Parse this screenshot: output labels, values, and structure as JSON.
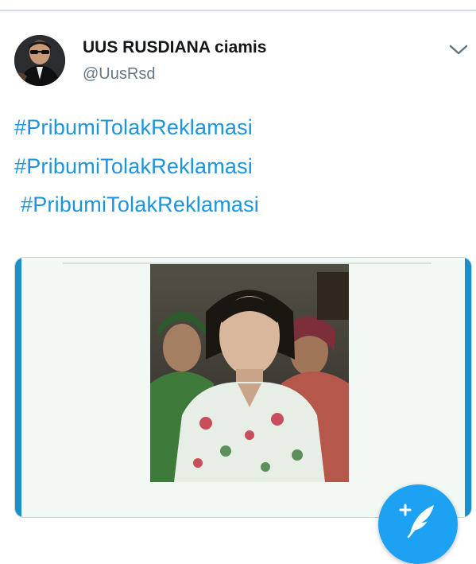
{
  "tweet": {
    "display_name": "UUS RUSDIANA ciamis",
    "handle": "@UusRsd",
    "hashtags": [
      "#PribumiTolakReklamasi",
      "#PribumiTolakReklamasi",
      "#PribumiTolakReklamasi"
    ]
  },
  "icons": {
    "menu": "chevron-down-icon",
    "compose": "compose-tweet-icon"
  },
  "colors": {
    "link": "#1b95e0",
    "fab": "#1da1f2",
    "name": "#14171a",
    "handle": "#657786"
  }
}
